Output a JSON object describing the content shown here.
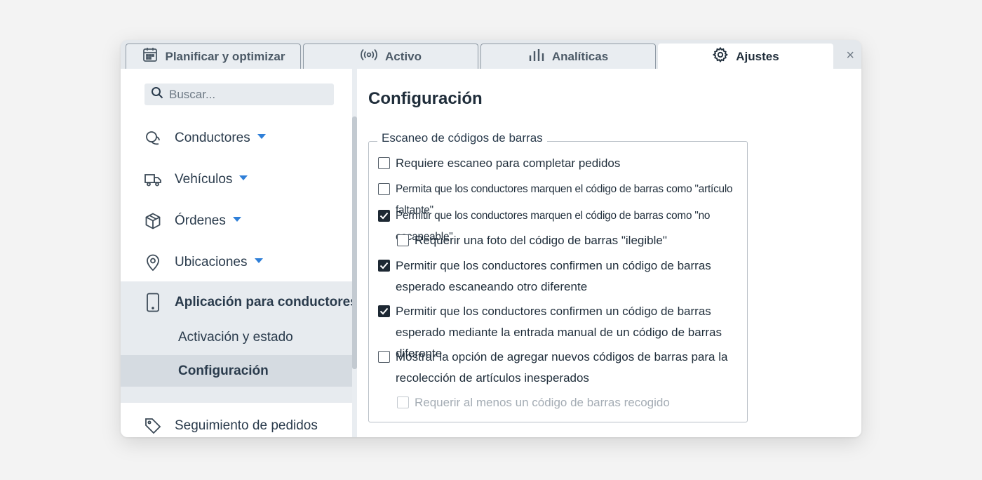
{
  "tabs": [
    {
      "label": "Planificar y optimizar",
      "icon": "calendar-icon"
    },
    {
      "label": "Activo",
      "icon": "broadcast-icon"
    },
    {
      "label": "Analíticas",
      "icon": "bar-chart-icon"
    },
    {
      "label": "Ajustes",
      "icon": "gear-icon",
      "active": true
    }
  ],
  "close_glyph": "×",
  "sidebar": {
    "search_placeholder": "Buscar...",
    "items": [
      {
        "label": "Conductores",
        "icon": "drivers-icon"
      },
      {
        "label": "Vehículos",
        "icon": "truck-icon"
      },
      {
        "label": "Órdenes",
        "icon": "box-icon"
      },
      {
        "label": "Ubicaciones",
        "icon": "location-pin-icon"
      },
      {
        "label": "Aplicación para conductores",
        "icon": "phone-icon",
        "expanded": true
      },
      {
        "label": "Seguimiento de pedidos",
        "icon": "tag-icon"
      }
    ],
    "subitems": [
      {
        "label": "Activación y estado"
      },
      {
        "label": "Configuración",
        "selected": true
      }
    ]
  },
  "main": {
    "title": "Configuración",
    "section_title": "Escaneo de códigos de barras",
    "options": [
      {
        "label": "Requiere escaneo para completar pedidos",
        "checked": false
      },
      {
        "label": "Permita que los conductores marquen el código de barras como \"artículo faltante\"",
        "checked": false
      },
      {
        "label": "Permitir que los conductores marquen el código de barras como \"no escaneable\"",
        "checked": true
      },
      {
        "label": "Requerir una foto del código de barras \"ilegible\"",
        "checked": false
      },
      {
        "label": "Permitir que los conductores confirmen un código de barras esperado escaneando otro diferente",
        "checked": true
      },
      {
        "label": "Permitir que los conductores confirmen un código de barras esperado mediante la entrada manual de un código de barras diferente",
        "checked": true
      },
      {
        "label": "Mostrar la opción de agregar nuevos códigos de barras para la recolección de artículos inesperados",
        "checked": false
      },
      {
        "label": "Requerir al menos un código de barras recogido",
        "checked": false,
        "disabled": true
      }
    ]
  },
  "colors": {
    "accent": "#2f7fd8",
    "selected_bg": "#d5dbe1",
    "checkbox_checked": "#1d2833"
  }
}
